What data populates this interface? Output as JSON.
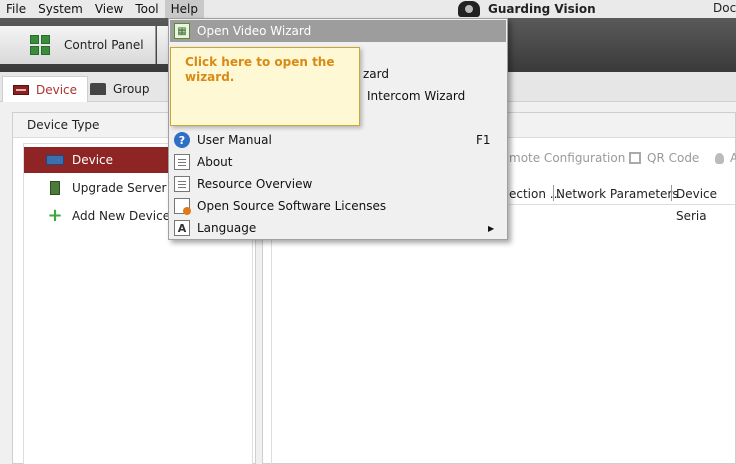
{
  "menubar": {
    "items": [
      "File",
      "System",
      "View",
      "Tool",
      "Help"
    ],
    "brand": "Guarding Vision",
    "right_text": "Doc"
  },
  "toolbar": {
    "control_panel_label": "Control Panel"
  },
  "tabs": {
    "device_label": "Device",
    "group_label": "Group"
  },
  "left_panel": {
    "header": "Device Type",
    "items": [
      {
        "label": "Device",
        "selected": true
      },
      {
        "label": "Upgrade Server",
        "selected": false
      },
      {
        "label": "Add New Device Ty",
        "selected": false
      }
    ]
  },
  "right_panel": {
    "tools": {
      "remote_config": "mote Configuration",
      "qr_code": "QR Code",
      "more": "A"
    },
    "columns": [
      "ection ...",
      "Network Parameters",
      "Device Seria"
    ]
  },
  "help_menu": {
    "items": [
      {
        "label": "Open Video Wizard",
        "icon": "wizard-icon",
        "highlighted": true
      },
      {
        "label": "zard",
        "icon": "",
        "partially_hidden": true
      },
      {
        "label": "Intercom Wizard",
        "icon": "",
        "partially_hidden": true
      },
      {
        "label": "User Manual",
        "icon": "help-icon",
        "shortcut": "F1"
      },
      {
        "label": "About",
        "icon": "document-icon"
      },
      {
        "label": "Resource Overview",
        "icon": "document-icon"
      },
      {
        "label": "Open Source Software Licenses",
        "icon": "license-icon"
      },
      {
        "label": "Language",
        "icon": "language-icon",
        "submenu_arrow": "▶"
      }
    ]
  },
  "tooltip": {
    "text": "Click here to open the wizard."
  },
  "colors": {
    "accent_red": "#8e2424",
    "tooltip_text": "#d88a14",
    "tooltip_bg": "#fff8d4"
  }
}
